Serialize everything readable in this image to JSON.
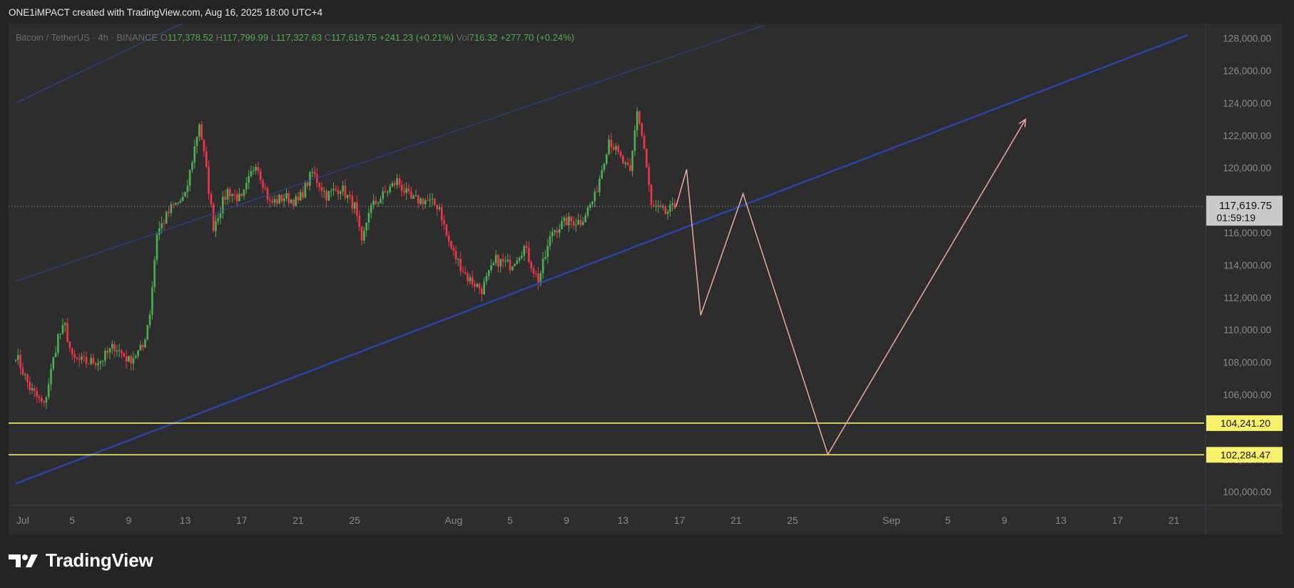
{
  "credit": "ONE1iMPACT created with TradingView.com, Aug 16, 2025 18:00 UTC+4",
  "brand": {
    "name": "TradingView",
    "logo_icon": "tradingview-logo-icon"
  },
  "legend": {
    "symbol": "Bitcoin / TetherUS · 4h · BINANCE",
    "o_label": "O",
    "o_value": "117,378.52",
    "h_label": "H",
    "h_value": "117,799.99",
    "l_label": "L",
    "l_value": "117,327.63",
    "c_label": "C",
    "c_value": "117,619.75",
    "change": "+241.23 (+0.21%)",
    "vol_label": "Vol",
    "vol_value": "716.32",
    "vol_change": "+277.70 (+0.24%)"
  },
  "price_badge": {
    "price": "117,619.75",
    "countdown": "01:59:19"
  },
  "colors": {
    "background": "#242424",
    "pane": "#2d2d2d",
    "up": "#4caf50",
    "down": "#f23645",
    "channel": "#2b44a8",
    "support": "#f7f06b",
    "projection": "#f0a7a0",
    "text": "#8a8a8a"
  },
  "chart_data": {
    "type": "candlestick",
    "symbol": "BTCUSDT",
    "interval": "4h",
    "ylim": [
      99000,
      129000
    ],
    "y_ticks": [
      100000,
      102000,
      104000,
      106000,
      108000,
      110000,
      112000,
      114000,
      116000,
      118000,
      120000,
      122000,
      124000,
      126000,
      128000
    ],
    "y_tick_labels": [
      "100,000.00",
      "102,000.00",
      "104,000.00",
      "106,000.00",
      "108,000.00",
      "110,000.00",
      "112,000.00",
      "114,000.00",
      "116,000.00",
      "118,000.00",
      "120,000.00",
      "122,000.00",
      "124,000.00",
      "126,000.00",
      "128,000.00"
    ],
    "x_range": [
      "2025-07-01",
      "2025-09-23"
    ],
    "x_ticks": [
      {
        "date": "2025-07-01",
        "label": "Jul"
      },
      {
        "date": "2025-07-05",
        "label": "5"
      },
      {
        "date": "2025-07-09",
        "label": "9"
      },
      {
        "date": "2025-07-13",
        "label": "13"
      },
      {
        "date": "2025-07-17",
        "label": "17"
      },
      {
        "date": "2025-07-21",
        "label": "21"
      },
      {
        "date": "2025-07-25",
        "label": "25"
      },
      {
        "date": "2025-08-01",
        "label": "Aug"
      },
      {
        "date": "2025-08-05",
        "label": "5"
      },
      {
        "date": "2025-08-09",
        "label": "9"
      },
      {
        "date": "2025-08-13",
        "label": "13"
      },
      {
        "date": "2025-08-17",
        "label": "17"
      },
      {
        "date": "2025-08-21",
        "label": "21"
      },
      {
        "date": "2025-08-25",
        "label": "25"
      },
      {
        "date": "2025-09-01",
        "label": "Sep"
      },
      {
        "date": "2025-09-05",
        "label": "5"
      },
      {
        "date": "2025-09-09",
        "label": "9"
      },
      {
        "date": "2025-09-13",
        "label": "13"
      },
      {
        "date": "2025-09-17",
        "label": "17"
      },
      {
        "date": "2025-09-21",
        "label": "21"
      }
    ],
    "close_path": [
      [
        "2025-07-01",
        108500
      ],
      [
        "2025-07-02",
        106400
      ],
      [
        "2025-07-03",
        105300
      ],
      [
        "2025-07-04",
        109600
      ],
      [
        "2025-07-04 12:00",
        110200
      ],
      [
        "2025-07-05",
        108200
      ],
      [
        "2025-07-06",
        108000
      ],
      [
        "2025-07-07",
        108100
      ],
      [
        "2025-07-08",
        109000
      ],
      [
        "2025-07-09",
        108100
      ],
      [
        "2025-07-10",
        108900
      ],
      [
        "2025-07-10 12:00",
        111100
      ],
      [
        "2025-07-11",
        116000
      ],
      [
        "2025-07-12",
        117500
      ],
      [
        "2025-07-13",
        118200
      ],
      [
        "2025-07-14",
        122800
      ],
      [
        "2025-07-14 12:00",
        119800
      ],
      [
        "2025-07-15",
        116400
      ],
      [
        "2025-07-16",
        118600
      ],
      [
        "2025-07-17",
        118000
      ],
      [
        "2025-07-18",
        120400
      ],
      [
        "2025-07-19",
        117800
      ],
      [
        "2025-07-20",
        118200
      ],
      [
        "2025-07-21",
        117900
      ],
      [
        "2025-07-22",
        119700
      ],
      [
        "2025-07-23",
        118300
      ],
      [
        "2025-07-24",
        118800
      ],
      [
        "2025-07-25",
        117600
      ],
      [
        "2025-07-25 12:00",
        115200
      ],
      [
        "2025-07-26",
        117400
      ],
      [
        "2025-07-27",
        118300
      ],
      [
        "2025-07-28",
        119200
      ],
      [
        "2025-07-29",
        118000
      ],
      [
        "2025-07-30",
        118000
      ],
      [
        "2025-07-31",
        117600
      ],
      [
        "2025-07-31 12:00",
        115800
      ],
      [
        "2025-08-01",
        114700
      ],
      [
        "2025-08-02",
        113200
      ],
      [
        "2025-08-03",
        112500
      ],
      [
        "2025-08-04",
        114300
      ],
      [
        "2025-08-05",
        114000
      ],
      [
        "2025-08-06",
        115100
      ],
      [
        "2025-08-07",
        113000
      ],
      [
        "2025-08-08",
        116100
      ],
      [
        "2025-08-09",
        116700
      ],
      [
        "2025-08-10",
        116700
      ],
      [
        "2025-08-11",
        118200
      ],
      [
        "2025-08-12",
        121800
      ],
      [
        "2025-08-13",
        120300
      ],
      [
        "2025-08-13 12:00",
        119600
      ],
      [
        "2025-08-14",
        123600
      ],
      [
        "2025-08-14 12:00",
        121200
      ],
      [
        "2025-08-15",
        117600
      ],
      [
        "2025-08-16",
        117200
      ],
      [
        "2025-08-16 18:00",
        117620
      ]
    ],
    "series": [
      {
        "kind": "last_price",
        "value": 117619.75
      },
      {
        "kind": "channel_line",
        "points": [
          [
            "2025-07-01",
            100500
          ],
          [
            "2025-09-22",
            128200
          ]
        ]
      },
      {
        "kind": "channel_line",
        "points": [
          [
            "2025-07-01",
            113000
          ],
          [
            "2025-08-23",
            128800
          ]
        ]
      },
      {
        "kind": "channel_line",
        "points": [
          [
            "2025-07-01",
            124000
          ],
          [
            "2025-07-13",
            129000
          ]
        ]
      },
      {
        "kind": "horizontal_level",
        "value": 104241.2,
        "label": "104,241.20"
      },
      {
        "kind": "horizontal_level",
        "value": 102284.47,
        "label": "102,284.47"
      },
      {
        "kind": "projection_path",
        "points": [
          [
            "2025-08-16 18:00",
            117600
          ],
          [
            "2025-08-17 12:00",
            119900
          ],
          [
            "2025-08-18 12:00",
            110900
          ],
          [
            "2025-08-21 12:00",
            118400
          ],
          [
            "2025-08-27 12:00",
            102300
          ],
          [
            "2025-09-10 12:00",
            123000
          ]
        ]
      }
    ]
  }
}
